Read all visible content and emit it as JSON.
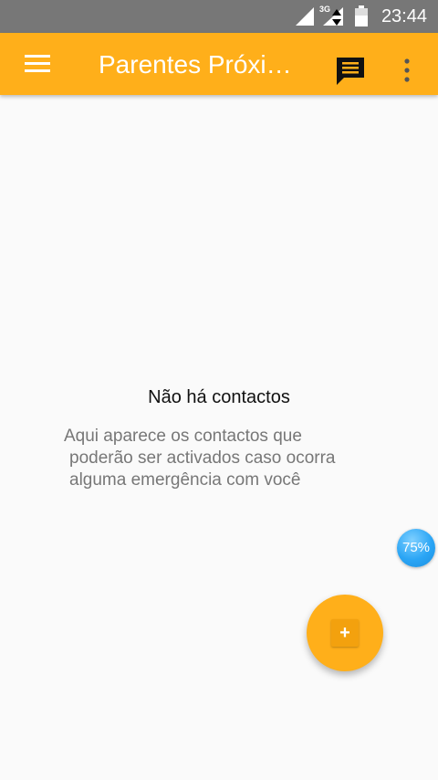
{
  "status_bar": {
    "network_type": "3G",
    "time": "23:44",
    "icons": [
      "signal-icon",
      "mobile-data-icon",
      "battery-icon"
    ]
  },
  "app_bar": {
    "title": "Parentes Próximos",
    "icons": [
      "menu-icon",
      "message-icon",
      "more-vert-icon"
    ],
    "color": "#ffaf1a"
  },
  "empty_state": {
    "title": "Não há contactos",
    "description_lines": [
      "Aqui aparece os contactos que",
      "poderão ser activados caso ocorra",
      "alguma emergência com você"
    ]
  },
  "floating_badge": {
    "text": "75%"
  },
  "fab": {
    "label": "+",
    "icon": "add-icon"
  }
}
